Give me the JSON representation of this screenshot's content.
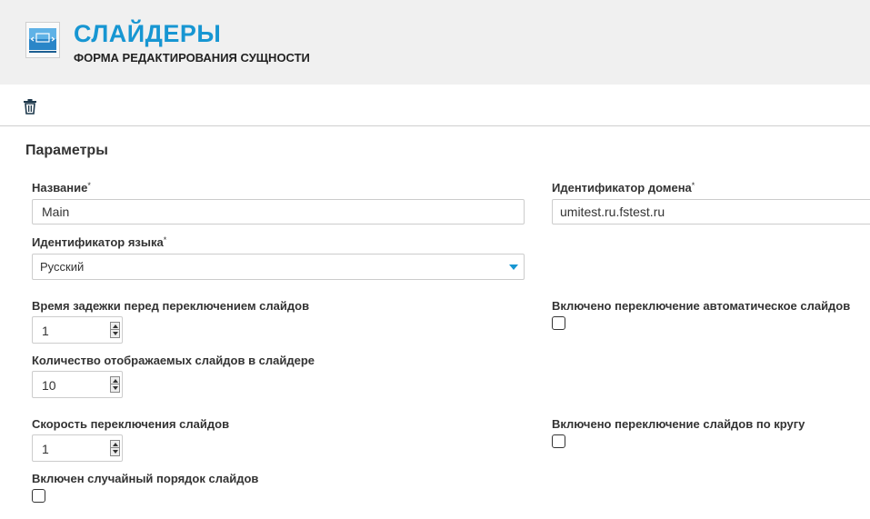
{
  "header": {
    "title": "СЛАЙДЕРЫ",
    "subtitle": "ФОРМА РЕДАКТИРОВАНИЯ СУЩНОСТИ",
    "icon": "slider-module-icon",
    "accent_color": "#1796d2"
  },
  "toolbar": {
    "delete_icon": "trash-icon"
  },
  "section": {
    "title": "Параметры"
  },
  "fields": {
    "name": {
      "label": "Название",
      "required_mark": "*",
      "value": "Main"
    },
    "domain_id": {
      "label": "Идентификатор домена",
      "required_mark": "*",
      "value": "umitest.ru.fstest.ru"
    },
    "language_id": {
      "label": "Идентификатор языка",
      "required_mark": "*",
      "selected": "Русский"
    },
    "delay": {
      "label": "Время задежки перед переключением слайдов",
      "value": "1"
    },
    "auto_switch": {
      "label": "Включено переключение автоматическое слайдов",
      "checked": false
    },
    "slides_count": {
      "label": "Количество отображаемых слайдов в слайдере",
      "value": "10"
    },
    "speed": {
      "label": "Скорость переключения слайдов",
      "value": "1"
    },
    "loop": {
      "label": "Включено переключение слайдов по кругу",
      "checked": false
    },
    "random_order": {
      "label": "Включен случайный порядок слайдов",
      "checked": false
    }
  }
}
